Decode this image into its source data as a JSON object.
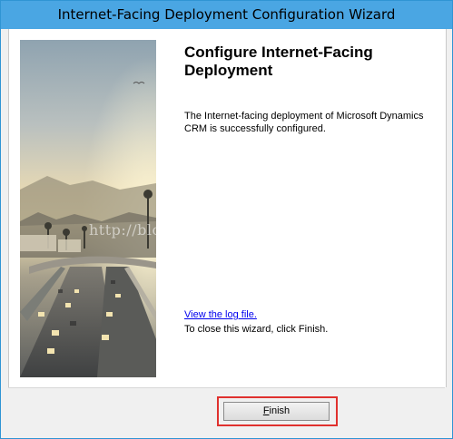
{
  "window": {
    "title": "Internet-Facing Deployment Configuration Wizard"
  },
  "main": {
    "heading": "Configure Internet-Facing Deployment",
    "body": "The Internet-facing deployment of Microsoft Dynamics CRM is successfully configured.",
    "log_link": "View the log file.",
    "close_text": "To close this wizard, click Finish."
  },
  "watermark": "http://blog.csdn.net/sytiao",
  "footer": {
    "finish_mnemonic": "F",
    "finish_rest": "inish"
  },
  "colors": {
    "titlebar": "#4aa6e3",
    "border": "#2f94d4",
    "highlight": "#e0312e",
    "link": "#0000ee"
  }
}
